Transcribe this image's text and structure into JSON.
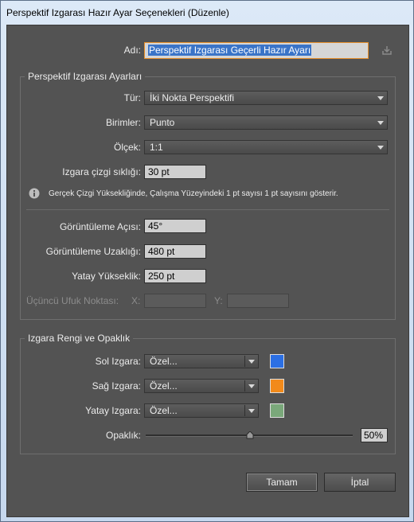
{
  "window": {
    "title": "Perspektif Izgarası Hazır Ayar Seçenekleri (Düzenle)"
  },
  "name_field": {
    "label": "Adı:",
    "value": "Perspektif Izgarası Geçerli Hazır Ayarı"
  },
  "settings": {
    "title": "Perspektif Izgarası Ayarları",
    "type": {
      "label": "Tür:",
      "value": "İki Nokta Perspektifi"
    },
    "units": {
      "label": "Birimler:",
      "value": "Punto"
    },
    "scale": {
      "label": "Ölçek:",
      "value": "1:1"
    },
    "gridline": {
      "label": "Izgara çizgi sıklığı:",
      "value": "30 pt"
    },
    "info": "Gerçek Çizgi Yüksekliğinde, Çalışma Yüzeyindeki 1 pt sayısı 1 pt sayısını gösterir.",
    "view_angle": {
      "label": "Görüntüleme Açısı:",
      "value": "45°"
    },
    "view_distance": {
      "label": "Görüntüleme Uzaklığı:",
      "value": "480 pt"
    },
    "horizon_height": {
      "label": "Yatay Yükseklik:",
      "value": "250 pt"
    },
    "third_vp": {
      "label": "Üçüncü Ufuk Noktası:",
      "x_label": "X:",
      "y_label": "Y:"
    }
  },
  "color": {
    "title": "Izgara Rengi ve Opaklık",
    "left": {
      "label": "Sol Izgara:",
      "value": "Özel...",
      "color": "#2b6fe4"
    },
    "right": {
      "label": "Sağ Izgara:",
      "value": "Özel...",
      "color": "#f28a1a"
    },
    "horizontal": {
      "label": "Yatay Izgara:",
      "value": "Özel...",
      "color": "#7aa87a"
    },
    "opacity": {
      "label": "Opaklık:",
      "value": "50%"
    }
  },
  "buttons": {
    "ok": "Tamam",
    "cancel": "İptal"
  }
}
